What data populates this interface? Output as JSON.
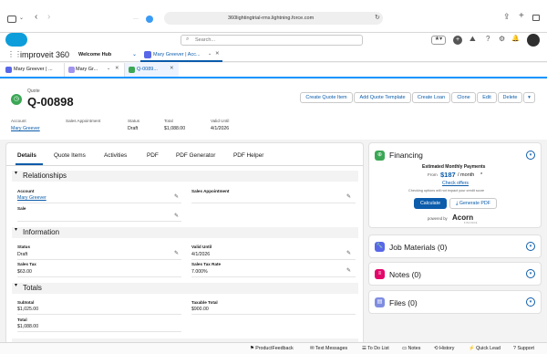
{
  "browser": {
    "url": "360lightingtrial-rms.lightning.force.com"
  },
  "header": {
    "search_placeholder": "Search..."
  },
  "appnav": {
    "app_name": "improveit 360",
    "tabs": [
      {
        "label": "Welcome Hub"
      },
      {
        "label": "Mary Greever | Acc..."
      }
    ]
  },
  "subtabs": [
    {
      "label": "Mary Greever | ..."
    },
    {
      "label": "Mary Gr..."
    },
    {
      "label": "Q-0089..."
    }
  ],
  "record": {
    "object": "Quote",
    "name": "Q-00898",
    "buttons": [
      "Create Quote Item",
      "Add Quote Template",
      "Create Loan",
      "Clone",
      "Edit",
      "Delete"
    ],
    "highlights": [
      {
        "label": "Account",
        "value": "Mary Greever"
      },
      {
        "label": "Sales Appointment",
        "value": ""
      },
      {
        "label": "Status",
        "value": "Draft"
      },
      {
        "label": "Total",
        "value": "$1,088.00"
      },
      {
        "label": "Valid Until",
        "value": "4/1/2026"
      }
    ]
  },
  "detail": {
    "tabs": [
      "Details",
      "Quote Items",
      "Activities",
      "PDF",
      "PDF Generator",
      "PDF Helper"
    ],
    "relationships": {
      "title": "Relationships",
      "account_label": "Account",
      "account_value": "Mary Greever",
      "sales_appt_label": "Sales Appointment",
      "sale_label": "Sale"
    },
    "information": {
      "title": "Information",
      "status_label": "Status",
      "status_value": "Draft",
      "valid_label": "Valid Until",
      "valid_value": "4/1/2026",
      "tax_label": "Sales Tax",
      "tax_value": "$63.00",
      "rate_label": "Sales Tax Rate",
      "rate_value": "7.000%"
    },
    "totals": {
      "title": "Totals",
      "subtotal_label": "Subtotal",
      "subtotal_value": "$1,025.00",
      "taxable_label": "Taxable Total",
      "taxable_value": "$900.00",
      "total_label": "Total",
      "total_value": "$1,088.00"
    }
  },
  "financing": {
    "title": "Financing",
    "est_label": "Estimated Monthly Payments",
    "from": "From",
    "amount": "$187",
    "per_month": "/ month",
    "asterisk": "*",
    "check_offers": "Check offers",
    "note": "Checking options will not impact your credit score",
    "calculate": "Calculate",
    "generate_pdf": "Generate PDF",
    "powered_by": "powered by",
    "acorn": "Acorn",
    "acorn_sub": "FINANCE"
  },
  "related": [
    {
      "title": "Job Materials (0)"
    },
    {
      "title": "Notes (0)"
    },
    {
      "title": "Files (0)"
    }
  ],
  "utility": [
    "ProductFeedback",
    "Text Messages",
    "To Do List",
    "Notes",
    "History",
    "Quick Lead",
    "Support"
  ],
  "colors": {
    "brand_blue": "#0b5cab",
    "salesforce_cloud": "#0d9dda",
    "quote_icon": "#3ba755",
    "financing_icon": "#3ba755",
    "job_icon": "#5867e8",
    "notes_icon": "#e3066a",
    "files_icon": "#7f8de1"
  }
}
